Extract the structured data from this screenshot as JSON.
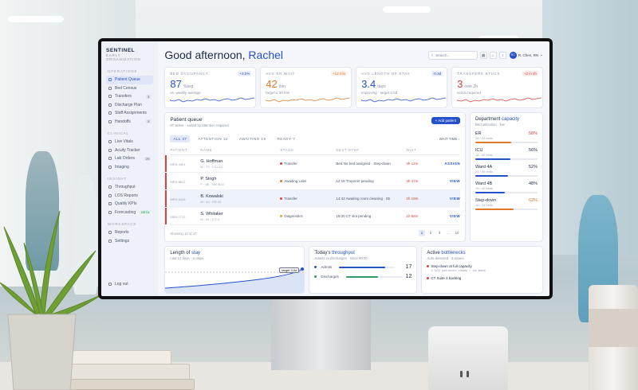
{
  "sidebar": {
    "brand": "SENTINEL",
    "brand_sub": "EARLY ORGANIZATION",
    "sections": [
      {
        "title": "OPERATIONS",
        "items": [
          {
            "label": "Patient Queue",
            "icon": "list-icon",
            "active": true,
            "badge": ""
          },
          {
            "label": "Bed Census",
            "icon": "bed-icon",
            "badge": ""
          },
          {
            "label": "Transfers",
            "icon": "transfer-icon",
            "badge": "3"
          },
          {
            "label": "Discharge Plan",
            "icon": "clipboard-icon",
            "badge": ""
          },
          {
            "label": "Staff Assignments",
            "icon": "users-icon",
            "badge": ""
          },
          {
            "label": "Handoffs",
            "icon": "handoff-icon",
            "badge": "5"
          }
        ]
      },
      {
        "title": "CLINICAL",
        "items": [
          {
            "label": "Live Vitals",
            "icon": "heart-icon",
            "badge": ""
          },
          {
            "label": "Acuity Tracker",
            "icon": "activity-icon",
            "badge": ""
          },
          {
            "label": "Lab Orders",
            "icon": "flask-icon",
            "badge": "29"
          },
          {
            "label": "Imaging",
            "icon": "image-icon",
            "badge": ""
          }
        ]
      },
      {
        "title": "INSIGHT",
        "items": [
          {
            "label": "Throughput",
            "icon": "chart-icon",
            "badge": ""
          },
          {
            "label": "LOS Reports",
            "icon": "report-icon",
            "badge": ""
          },
          {
            "label": "Quality KPIs",
            "icon": "star-icon",
            "badge": ""
          },
          {
            "label": "Forecasting",
            "icon": "trend-icon",
            "badge": "BETA"
          }
        ]
      },
      {
        "title": "WORKSPACE",
        "items": [
          {
            "label": "Reports",
            "icon": "file-icon",
            "badge": ""
          },
          {
            "label": "Settings",
            "icon": "gear-icon",
            "badge": ""
          }
        ]
      }
    ],
    "logout": "Log out"
  },
  "header": {
    "greeting": "Good afternoon,",
    "name": "Rachel",
    "search_placeholder": "Search...",
    "user_initials": "RC",
    "user_name": "R. Chen, RN"
  },
  "kpis": [
    {
      "title": "BED OCCUPANCY",
      "delta": "+3.2%",
      "delta_color": "#2451c9",
      "value": "87",
      "unit": "%avg",
      "sub": "vs. weekly average",
      "color": "#2451c9"
    },
    {
      "title": "AVG ER WAIT",
      "delta": "+12 min",
      "delta_color": "#e07a2b",
      "value": "42",
      "unit": "min",
      "sub": "target ≤ 30 min",
      "color": "#e07a2b"
    },
    {
      "title": "AVG LENGTH OF STAY",
      "delta": "-0.3d",
      "delta_color": "#2451c9",
      "value": "3.4",
      "unit": "days",
      "sub": "improving · target 3.0d",
      "color": "#2451c9"
    },
    {
      "title": "TRANSFERS STUCK",
      "delta": "+2 in 4h",
      "delta_color": "#d6453d",
      "value": "3",
      "unit": "over 2h",
      "sub": "action required",
      "color": "#d6453d"
    }
  ],
  "queue": {
    "title": "Patient queue",
    "sub": "87 active · sorted by attention required",
    "add_label": "+ Add patient",
    "filters": [
      "ALL 47",
      "ATTENTION 12",
      "AWAITING 15",
      "READY 7"
    ],
    "sort": "WAIT TIME ↓",
    "columns": [
      "PATIENT",
      "NAME",
      "STAGE",
      "NEXT STEP",
      "WAIT",
      ""
    ],
    "rows": [
      {
        "mrn": "MRN 4401",
        "name": "G. Hoffman",
        "detail": "M · 72 · ICU 22",
        "stage": "Transfer",
        "stage_color": "#d6453d",
        "next": "Bed No bed assigned · Step-down",
        "wait": "4h 12m",
        "action": "ASSIGN",
        "accent": true
      },
      {
        "mrn": "MRN 8512",
        "name": "P. Singh",
        "detail": "F · 58 · 3S0 B14",
        "stage": "Awaiting Labs",
        "stage_color": "#e07a2b",
        "next": "12:18 Troponin pending",
        "wait": "3h 47m",
        "action": "VIEW",
        "accent": true
      },
      {
        "mrn": "MRN 6428",
        "name": "B. Kowalski",
        "detail": "M · 44 · ER 02",
        "stage": "Transfer",
        "stage_color": "#d6453d",
        "next": "14:42 Awaiting room cleaning · 05",
        "wait": "2h 19m",
        "action": "VIEW",
        "accent": true,
        "highlight": true
      },
      {
        "mrn": "MRN 7712",
        "name": "S. Whitaker",
        "detail": "M · 61 · CT-3",
        "stage": "Diagnostics",
        "stage_color": "#e0a92b",
        "next": "15:20 CT slot pending",
        "wait": "1h 58m",
        "action": "VIEW",
        "accent": true
      }
    ],
    "footer": "Showing 10 of 47",
    "pages": [
      "1",
      "2",
      "3",
      "…",
      "10"
    ]
  },
  "capacity": {
    "title": "Department",
    "title_accent": "capacity",
    "sub": "Bed utilization · live",
    "wards": [
      {
        "name": "ER",
        "beds": "28 / 24 beds",
        "pct": "58%",
        "fill": 0.58,
        "color": "#e07a2b",
        "pct_color": "#d6453d"
      },
      {
        "name": "ICU",
        "beds": "18 / 32 beds",
        "pct": "56%",
        "fill": 0.56,
        "color": "#2451c9",
        "pct_color": "#1f2a40"
      },
      {
        "name": "Ward 4A",
        "beds": "21 / 40 beds",
        "pct": "52%",
        "fill": 0.52,
        "color": "#2451c9",
        "pct_color": "#1f2a40"
      },
      {
        "name": "Ward 4B",
        "beds": "19 / 40 beds",
        "pct": "48%",
        "fill": 0.48,
        "color": "#2451c9",
        "pct_color": "#1f2a40"
      },
      {
        "name": "Step-down",
        "beds": "15 / 24 beds",
        "pct": "62%",
        "fill": 0.62,
        "color": "#e07a2b",
        "pct_color": "#e07a2b"
      }
    ]
  },
  "stay": {
    "title": "Length of",
    "title_accent": "stay",
    "sub": "Last 14 days · in days",
    "target_label": "target 3.0d"
  },
  "throughput": {
    "title": "Today's",
    "title_accent": "throughput",
    "sub": "Admits vs discharges · since 00:00",
    "rows": [
      {
        "label": "Admits",
        "value": "17",
        "fill": 0.82,
        "color": "#2451c9"
      },
      {
        "label": "Discharges",
        "value": "12",
        "fill": 0.58,
        "color": "#2e9d63"
      }
    ]
  },
  "bottlenecks": {
    "title": "Active",
    "title_accent": "bottlenecks",
    "sub": "Auto-detected · 3 issues",
    "items": [
      {
        "label": "Step-down at full capacity",
        "meta": "2 ICU patients ready · no beds"
      },
      {
        "label": "CT Suite 3 backlog",
        "meta": ""
      }
    ]
  }
}
